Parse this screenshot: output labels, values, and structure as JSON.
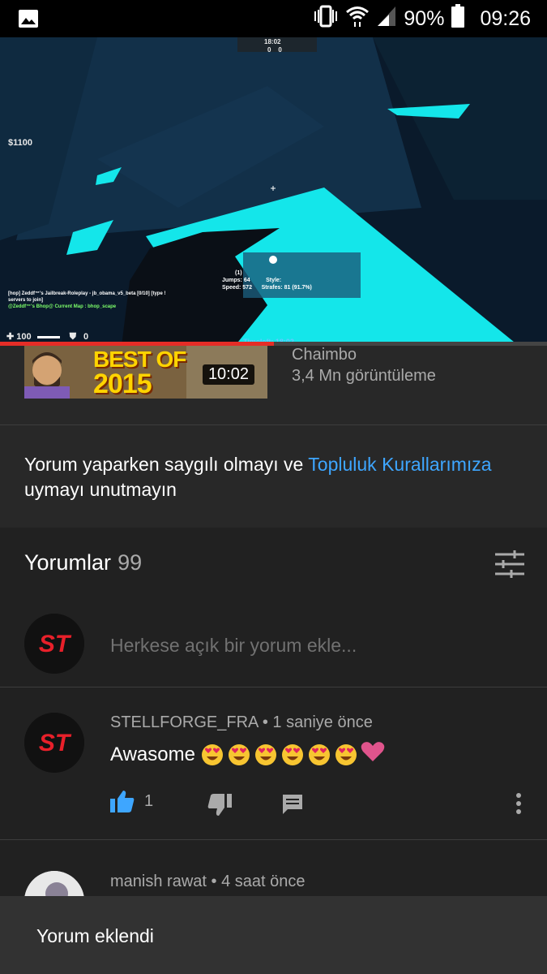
{
  "status_bar": {
    "battery_percent": "90%",
    "time": "09:26",
    "icons": [
      "image-icon",
      "vibrate-icon",
      "wifi-icon",
      "signal-icon",
      "battery-icon"
    ]
  },
  "video": {
    "hud_money": "$1100",
    "hud_round_time": "18:02",
    "hud_score_left": "0",
    "hud_score_right": "0",
    "hud_health": "100",
    "hud_armor": "0",
    "hud_timeleft": "Timeleft: 18:02",
    "hud_stats_line1": "(1)",
    "hud_stats_jumps": "Jumps: 64",
    "hud_stats_style": "Style:",
    "hud_stats_speed": "Speed: 572",
    "hud_stats_strafes": "Strafes: 81 (91.7%)",
    "hud_chat_line1": "[hop] Zeddf™'s Jailbreak-Roleplay - jb_obama_v5_beta [0/10] [type !",
    "hud_chat_line2": "servers to join]",
    "hud_chat_line3": "@Zeddf™'s Bhop@ Current Map : bhop_scape",
    "progress_fraction": 0.5
  },
  "related": {
    "thumbnail_text_line1": "BEST OF",
    "thumbnail_text_line2": "2015",
    "duration": "10:02",
    "channel": "Chaimbo",
    "views": "3,4 Mn görüntüleme"
  },
  "notice": {
    "text_before": "Yorum yaparken saygılı olmayı ve ",
    "link": "Topluluk Kurallarımıza",
    "text_after": " uymayı unutmayın"
  },
  "comments": {
    "title": "Yorumlar",
    "count": "99",
    "add_placeholder": "Herkese açık bir yorum ekle...",
    "items": [
      {
        "author": "STELLFORGE_FRA",
        "time": "1 saniye önce",
        "text": "Awasome",
        "emoji_count": 6,
        "likes": "1"
      },
      {
        "author": "manish rawat",
        "time": "4 saat önce"
      }
    ]
  },
  "snackbar": {
    "message": "Yorum eklendi"
  },
  "colors": {
    "accent": "#3ea6ff",
    "like_active": "#3ea6ff",
    "progress": "#e52d27",
    "background": "#212121"
  }
}
